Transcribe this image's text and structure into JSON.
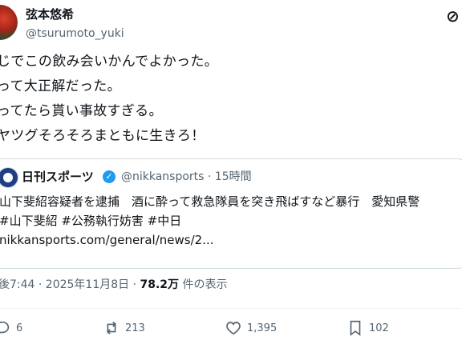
{
  "author": {
    "name": "弦本悠希",
    "handle": "@tsurumoto_yuki"
  },
  "tweet": {
    "lines": [
      "じでこの飲み会いかんでよかった。",
      "って大正解だった。",
      "ってたら貰い事故すぎる。",
      "ヤツグそろそろまともに生きろ！"
    ]
  },
  "quote": {
    "name": "日刊スポーツ",
    "meta": "@nikkansports · 15時間",
    "lines": [
      "山下斐紹容疑者を逮捕　酒に酔って救急隊員を突き飛ばすなど暴行　愛知県警",
      "#山下斐紹 #公務執行妨害 #中日",
      "nikkansports.com/general/news/2..."
    ]
  },
  "timestamp": "後7:44 · 2025年11月8日 · ",
  "views": {
    "count": "78.2万",
    "label": " 件の表示"
  },
  "actions": {
    "replies": "6",
    "reposts": "213",
    "likes": "1,395",
    "bookmarks": "102"
  }
}
